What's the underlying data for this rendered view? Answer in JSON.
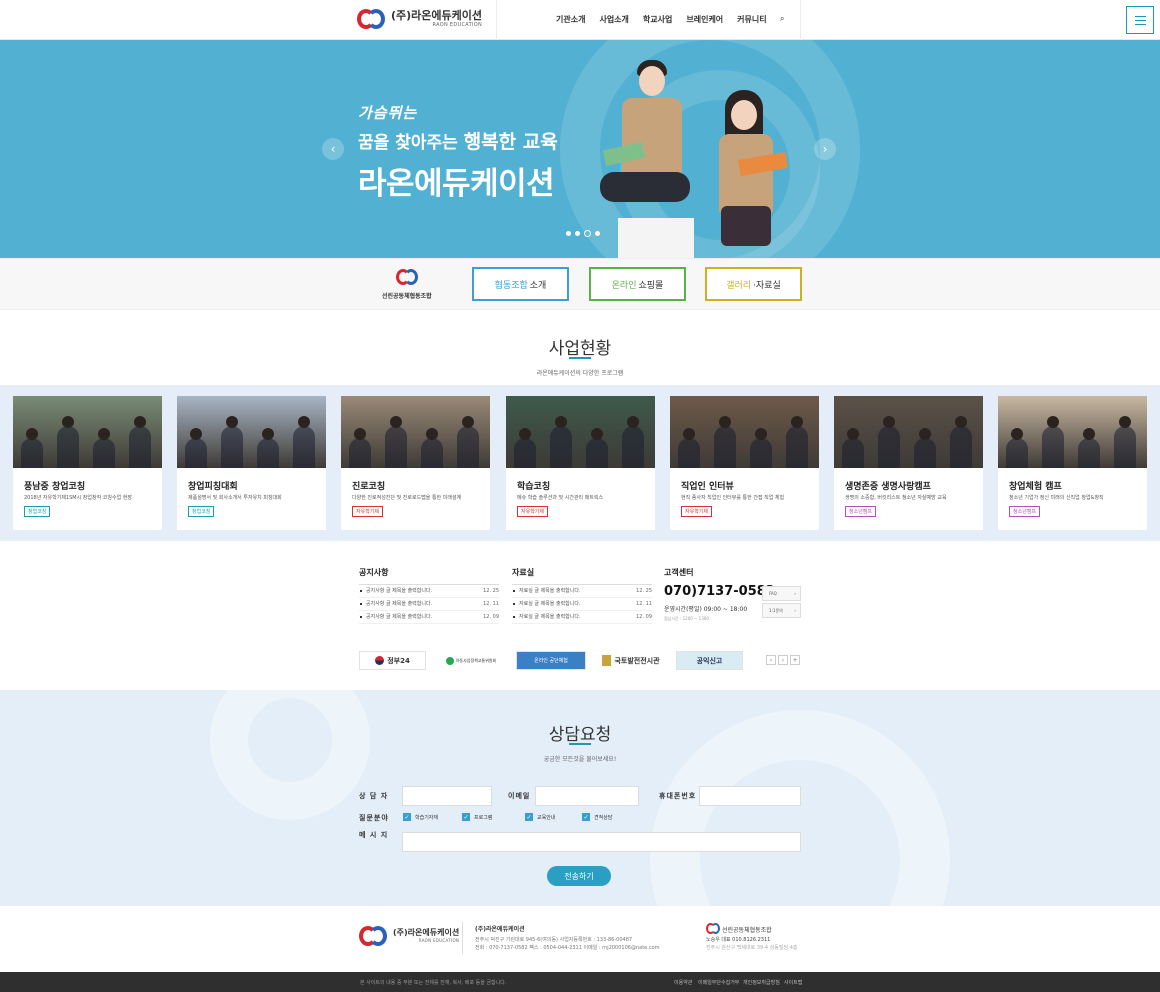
{
  "header": {
    "logo_text": "(주)라온에듀케이션",
    "logo_sub": "RAON EDUCATION",
    "nav": [
      "기관소개",
      "사업소개",
      "학교사업",
      "브레인케어",
      "커뮤니티"
    ],
    "search_glyph": "⌕"
  },
  "hero": {
    "line1": "가슴뛰는",
    "line2a": "꿈을 찾아주는",
    "line2b": "행복한 교육",
    "line3": "라온에듀케이션",
    "prev_glyph": "‹",
    "next_glyph": "›",
    "slide_count": 4,
    "active_slide": 3
  },
  "coop": {
    "logo_name": "선린공동체협동조합",
    "buttons": [
      {
        "highlight": "협동조합",
        "rest": "소개",
        "color": "#3ea0d0"
      },
      {
        "highlight": "온라인",
        "rest": "쇼핑몰",
        "color": "#5cb04a"
      },
      {
        "highlight": "갤러리",
        "rest": "·자료실",
        "color": "#cbb21e"
      }
    ]
  },
  "business": {
    "title": "사업현황",
    "subtitle": "라온에듀케이션의 다양한 프로그램",
    "cards": [
      {
        "title": "풍남중 창업코칭",
        "desc": "2018년 자유학기제1SM시 창업창작 코칭수업 현장",
        "tag": "창업코칭",
        "tag_color": "#1e9ab3",
        "photo": "#7a8c76"
      },
      {
        "title": "창업피칭대회",
        "desc": "제품설명서 및 회사소개서 투자유치 피칭대회",
        "tag": "창업코칭",
        "tag_color": "#1e9ab3",
        "photo": "#a8b5c4"
      },
      {
        "title": "진로코칭",
        "desc": "다양한 진로적성진단 및 진로로드맵을 통한 미래설계",
        "tag": "자유학기제",
        "tag_color": "#d6313a",
        "photo": "#9a8a78"
      },
      {
        "title": "학습코칭",
        "desc": "메슈 학습 솔루션과 및 시간관리 매트릭스",
        "tag": "자유학기제",
        "tag_color": "#d6313a",
        "photo": "#3f5a4c"
      },
      {
        "title": "직업인 인터뷰",
        "desc": "현직 종사자 직업인 인터뷰를 통한 간접 직업 체험",
        "tag": "자유학기제",
        "tag_color": "#d6313a",
        "photo": "#6e5a4a"
      },
      {
        "title": "생명존중 생명사랑캠프",
        "desc": "생명의 소중함, 버킷리스트 청소년 자살예방 교육",
        "tag": "청소년캠프",
        "tag_color": "#b34fb8",
        "photo": "#5b5148"
      },
      {
        "title": "창업체험 캠프",
        "desc": "청소년 기업가 정신 미래의 신직업 창업&창직",
        "tag": "청소년캠프",
        "tag_color": "#b34fb8",
        "photo": "#c9b9a2"
      }
    ]
  },
  "boards": {
    "notice": {
      "title": "공지사항",
      "items": [
        {
          "text": "공지사항 글 제목을 출력합니다.",
          "date": "12. 25"
        },
        {
          "text": "공지사항 글 제목을 출력합니다.",
          "date": "12. 11"
        },
        {
          "text": "공지사항 글 제목을 출력합니다.",
          "date": "12. 09"
        }
      ]
    },
    "archive": {
      "title": "자료실",
      "items": [
        {
          "text": "자료실 글 제목을 출력합니다.",
          "date": "12. 25"
        },
        {
          "text": "자료실 글 제목을 출력합니다.",
          "date": "12. 11"
        },
        {
          "text": "자료실 글 제목을 출력합니다.",
          "date": "12. 09"
        }
      ]
    },
    "support": {
      "title": "고객센터",
      "tel": "070)7137-0582",
      "hours": "운영시간(평일)  09:00  ~  18:00",
      "lunch": "점심시간 : 1200 ~ 1300",
      "faq": "FAQ",
      "qna": "1:1문의",
      "arrow": "›"
    }
  },
  "partners": {
    "items": [
      "정부24",
      "아동사업정책교통위원회",
      "온라인 공단체험",
      "국토발전전시관",
      "공익신고"
    ],
    "prev": "‹",
    "next": "›",
    "more": "+"
  },
  "consult": {
    "title": "상담요청",
    "subtitle": "궁금한 모든것을 물어보세요!",
    "labels": {
      "name": "상 담 자",
      "email": "이메일",
      "phone": "휴대폰번호",
      "field": "질문분야",
      "message": "메 시 지"
    },
    "values": {
      "name": "",
      "email": "",
      "phone": "",
      "message": ""
    },
    "options": [
      "학습기자재",
      "프로그램",
      "교육안내",
      "견적상담"
    ],
    "check_glyph": "✓",
    "submit": "전송하기"
  },
  "footer": {
    "logo_text": "(주)라온에듀케이션",
    "logo_sub": "RAON EDUCATION",
    "company": "(주)라온에듀케이션",
    "addr": "전주시 덕진구 기린대로 945-6(여의동)    사업자등록번호 : 133-86-00487",
    "contact": "전화 : 070-7137-0582    팩스 : 0504-044-2311    이메일 : rnj2000106@nate.com",
    "coop_name": "선린공동체협동조합",
    "coop_line1": "노승우 대표  010.8126.2311",
    "coop_line2": "전주시 완산구 백제대로 39-4 성동빌딩 4층",
    "copyright": "본 사이트의 내용 중 무분 또는 전체를 전재, 복사, 배포 등을 금합니다.",
    "links": [
      "이용약관",
      "이메일무단수집거부",
      "개인정보취급방침",
      "사이트맵"
    ]
  }
}
